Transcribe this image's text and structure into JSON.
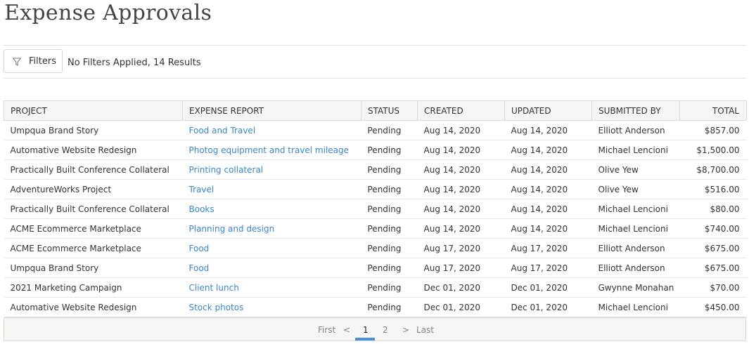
{
  "page": {
    "title": "Expense Approvals"
  },
  "filters": {
    "button_label": "Filters",
    "summary": "No Filters Applied, 14 Results"
  },
  "table": {
    "columns": [
      "PROJECT",
      "EXPENSE REPORT",
      "STATUS",
      "CREATED",
      "UPDATED",
      "SUBMITTED BY",
      "TOTAL"
    ],
    "rows": [
      {
        "project": "Umpqua Brand Story",
        "report": "Food and Travel",
        "status": "Pending",
        "created": "Aug 14, 2020",
        "updated": "Aug 14, 2020",
        "submitted_by": "Elliott Anderson",
        "total": "$857.00"
      },
      {
        "project": "Automative Website Redesign",
        "report": "Photog equipment and travel mileage",
        "status": "Pending",
        "created": "Aug 14, 2020",
        "updated": "Aug 14, 2020",
        "submitted_by": "Michael Lencioni",
        "total": "$1,500.00"
      },
      {
        "project": "Practically Built Conference Collateral",
        "report": "Printing collateral",
        "status": "Pending",
        "created": "Aug 14, 2020",
        "updated": "Aug 14, 2020",
        "submitted_by": "Olive Yew",
        "total": "$8,700.00"
      },
      {
        "project": "AdventureWorks Project",
        "report": "Travel",
        "status": "Pending",
        "created": "Aug 14, 2020",
        "updated": "Aug 14, 2020",
        "submitted_by": "Olive Yew",
        "total": "$516.00"
      },
      {
        "project": "Practically Built Conference Collateral",
        "report": "Books",
        "status": "Pending",
        "created": "Aug 14, 2020",
        "updated": "Aug 14, 2020",
        "submitted_by": "Michael Lencioni",
        "total": "$80.00"
      },
      {
        "project": "ACME Ecommerce Marketplace",
        "report": "Planning and design",
        "status": "Pending",
        "created": "Aug 14, 2020",
        "updated": "Aug 14, 2020",
        "submitted_by": "Michael Lencioni",
        "total": "$740.00"
      },
      {
        "project": "ACME Ecommerce Marketplace",
        "report": "Food",
        "status": "Pending",
        "created": "Aug 17, 2020",
        "updated": "Aug 17, 2020",
        "submitted_by": "Elliott Anderson",
        "total": "$675.00"
      },
      {
        "project": "Umpqua Brand Story",
        "report": "Food",
        "status": "Pending",
        "created": "Aug 17, 2020",
        "updated": "Aug 17, 2020",
        "submitted_by": "Elliott Anderson",
        "total": "$675.00"
      },
      {
        "project": "2021 Marketing Campaign",
        "report": "Client lunch",
        "status": "Pending",
        "created": "Dec 01, 2020",
        "updated": "Dec 01, 2020",
        "submitted_by": "Gwynne Monahan",
        "total": "$70.00"
      },
      {
        "project": "Automative Website Redesign",
        "report": "Stock photos",
        "status": "Pending",
        "created": "Dec 01, 2020",
        "updated": "Dec 01, 2020",
        "submitted_by": "Michael Lencioni",
        "total": "$450.00"
      }
    ]
  },
  "pagination": {
    "first": "First",
    "prev": "<",
    "pages": [
      "1",
      "2"
    ],
    "current": "1",
    "next": ">",
    "last": "Last"
  },
  "colors": {
    "link": "#3a86c8",
    "active_page": "#4a90d9"
  },
  "icons": {
    "filter": "filter-funnel-icon"
  }
}
